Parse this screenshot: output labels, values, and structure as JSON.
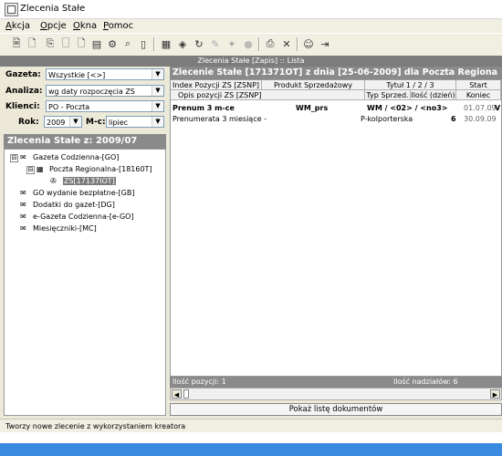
{
  "window": {
    "title": "Zlecenia Stałe"
  },
  "menu": [
    {
      "label": "Akcja"
    },
    {
      "label": "Opcje"
    },
    {
      "label": "Okna"
    },
    {
      "label": "Pomoc"
    }
  ],
  "toolbar": {
    "icons": [
      "new-wizard-icon",
      "edit-icon",
      "copy-icon",
      "document-icon",
      "page-icon",
      "report-icon",
      "settings-icon",
      "magnifier-icon",
      "book-icon",
      "calculator-icon",
      "process-icon",
      "refresh-icon",
      "tool-icon",
      "wizard-icon",
      "record-icon",
      "printer-icon",
      "delete-icon",
      "smiley-icon",
      "exit-icon"
    ]
  },
  "header_strip": "Zlecenia Stałe [Zapis] :: Lista",
  "filters": {
    "gazeta_label": "Gazeta:",
    "gazeta_value": "Wszystkie [<>]",
    "analiza_label": "Analiza:",
    "analiza_value": "wg daty rozpoczęcia ZS",
    "klienci_label": "Klienci:",
    "klienci_value": "PO - Poczta",
    "rok_label": "Rok:",
    "rok_value": "2009",
    "mc_label": "M-c:",
    "mc_value": "lipiec"
  },
  "left_section_title": "Zlecenia Stałe z: 2009/07",
  "tree": [
    {
      "label": "Gazeta Codzienna-[GO]",
      "expander": "⊟"
    },
    {
      "label": "Poczta Regionalna-[18160T]",
      "expander": "⊟"
    },
    {
      "label": "ZS[17137IOT]",
      "expander": ""
    },
    {
      "label": "GO wydanie bezpłatne-[GB]",
      "expander": ""
    },
    {
      "label": "Dodatki do gazet-[DG]",
      "expander": ""
    },
    {
      "label": "e-Gazeta Codzienna-[e-GO]",
      "expander": ""
    },
    {
      "label": "Miesięczniki-[MC]",
      "expander": ""
    }
  ],
  "right_title": "Zlecenie Stałe [171371OT] z dnia [25-06-2009] dla Poczta Regiona",
  "grid": {
    "headers_row1": [
      "Index Pozycji ZS [ZSNP]",
      "Produkt Sprzedażowy",
      "Tytuł 1 / 2 / 3",
      "Start"
    ],
    "headers_row2": [
      "Opis pozycji ZS [ZSNP]",
      "Typ Sprzed.",
      "Ilość (dzień)",
      "Koniec"
    ],
    "row1": {
      "index": "Prenum 3 m-ce",
      "product": "WM_prs",
      "titles": "WM / <02> / <no3>",
      "start": "01.07.09",
      "flag": "V"
    },
    "row2": {
      "desc": "Prenumerata 3 miesiące -",
      "type": "P-kolporterska",
      "qty": "6",
      "end": "30.09.09"
    }
  },
  "grid_footer": {
    "positions": "Ilość pozycji: 1",
    "senders": "Ilość nadziałów: 6"
  },
  "show_docs_button": "Pokaż listę dokumentów",
  "status_text": "Tworzy nowe zlecenie z wykorzystaniem kreatora",
  "colors": {
    "accent_header": "#8a8a8a",
    "taskbar": "#3a8be0"
  }
}
